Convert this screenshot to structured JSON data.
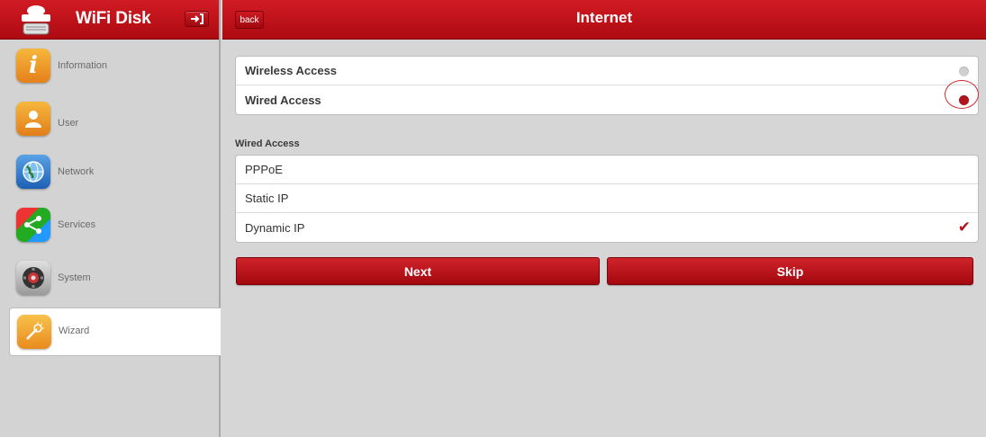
{
  "sidebar": {
    "title": "WiFi Disk",
    "items": [
      {
        "label": "Information",
        "icon": "info-icon"
      },
      {
        "label": "User",
        "icon": "user-icon"
      },
      {
        "label": "Network",
        "icon": "globe-icon"
      },
      {
        "label": "Services",
        "icon": "share-icon"
      },
      {
        "label": "System",
        "icon": "gear-icon"
      },
      {
        "label": "Wizard",
        "icon": "wand-icon",
        "active": true
      }
    ]
  },
  "header": {
    "back_label": "back",
    "title": "Internet"
  },
  "access": {
    "options": [
      {
        "label": "Wireless Access",
        "selected": false
      },
      {
        "label": "Wired Access",
        "selected": true
      }
    ]
  },
  "wired": {
    "section_title": "Wired Access",
    "options": [
      {
        "label": "PPPoE",
        "checked": false
      },
      {
        "label": "Static IP",
        "checked": false
      },
      {
        "label": "Dynamic IP",
        "checked": true
      }
    ]
  },
  "actions": {
    "next_label": "Next",
    "skip_label": "Skip"
  },
  "colors": {
    "accent": "#b0151d",
    "header": "#c3121a"
  }
}
